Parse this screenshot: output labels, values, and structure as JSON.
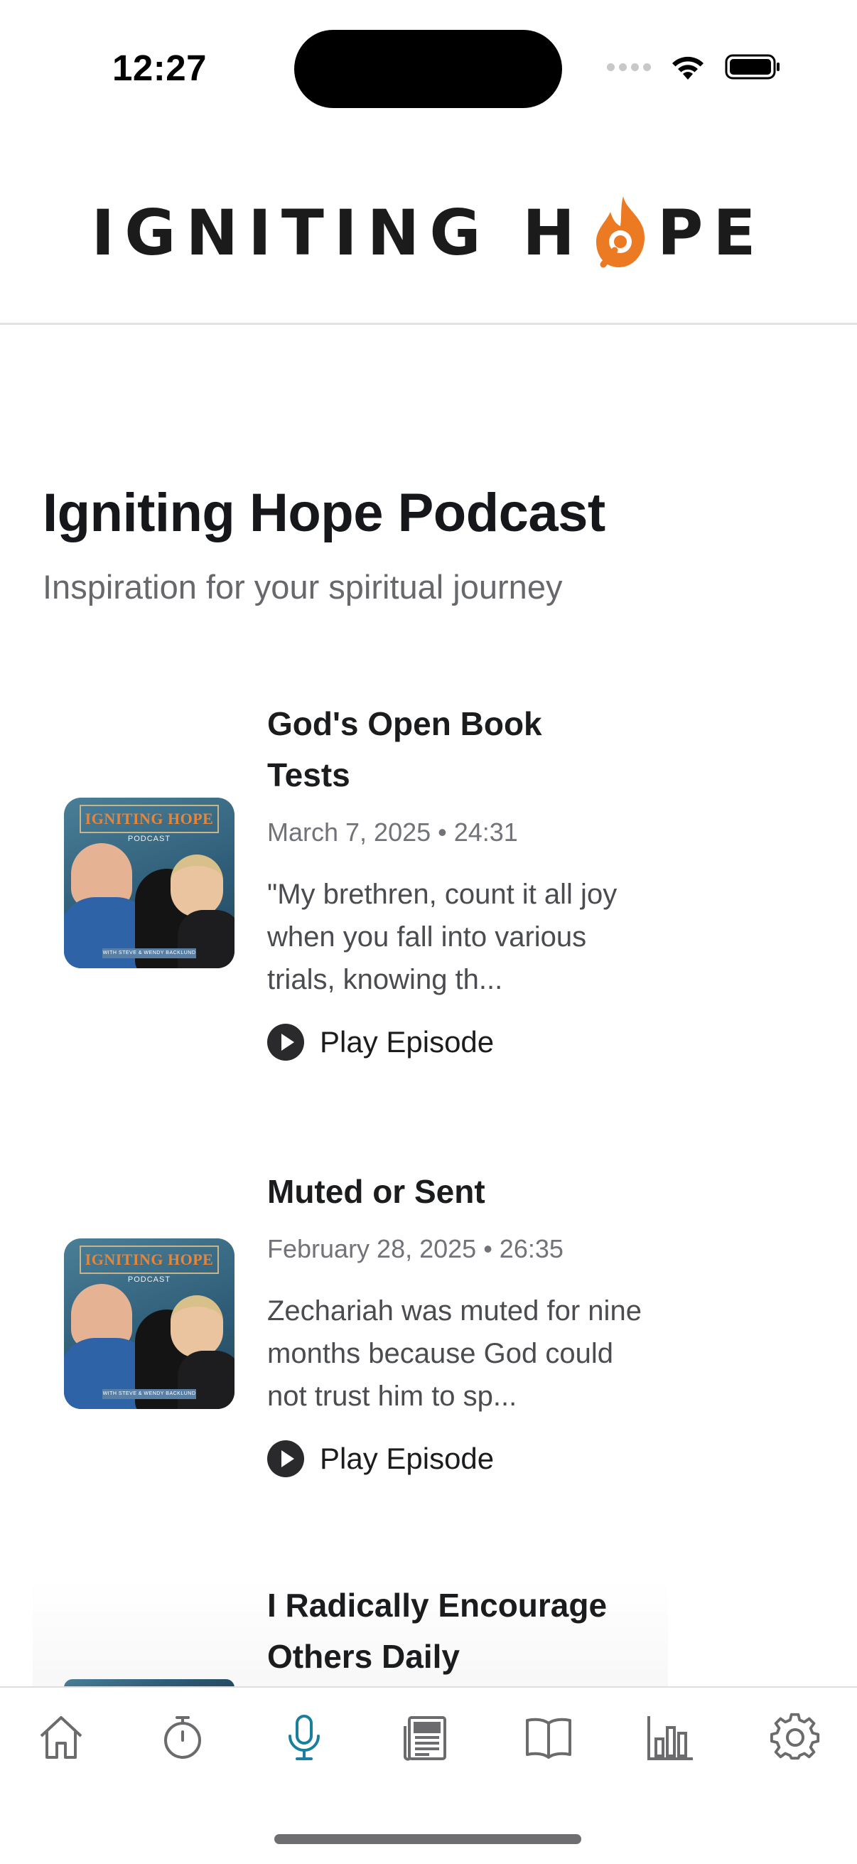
{
  "status_bar": {
    "time": "12:27"
  },
  "header": {
    "logo_text_left": "IGNITING H",
    "logo_text_right": "PE"
  },
  "page": {
    "title": "Igniting Hope Podcast",
    "subtitle": "Inspiration for your spiritual journey"
  },
  "episodes": [
    {
      "title": "God's Open Book Tests",
      "meta": "March 7, 2025 • 24:31",
      "description": "\"My brethren, count it all joy when you fall into various trials, knowing th...",
      "play_label": "Play Episode"
    },
    {
      "title": "Muted or Sent",
      "meta": "February 28, 2025 • 26:35",
      "description": "Zechariah was muted for nine months because God could not trust him to sp...",
      "play_label": "Play Episode"
    },
    {
      "title": "I Radically Encourage Others Daily"
    }
  ],
  "thumbnail": {
    "banner": "IGNITING HOPE",
    "sub": "PODCAST",
    "footer": "WITH STEVE & WENDY BACKLUND"
  },
  "tabbar": {
    "items": [
      {
        "icon": "home-icon"
      },
      {
        "icon": "timer-icon"
      },
      {
        "icon": "microphone-icon",
        "active": true
      },
      {
        "icon": "newspaper-icon"
      },
      {
        "icon": "book-icon"
      },
      {
        "icon": "bar-chart-icon"
      },
      {
        "icon": "gear-icon"
      }
    ]
  },
  "colors": {
    "accent": "#1a7e9e",
    "logo_orange": "#ec7a22",
    "text": "#1b1c1e",
    "muted": "#66686c"
  }
}
